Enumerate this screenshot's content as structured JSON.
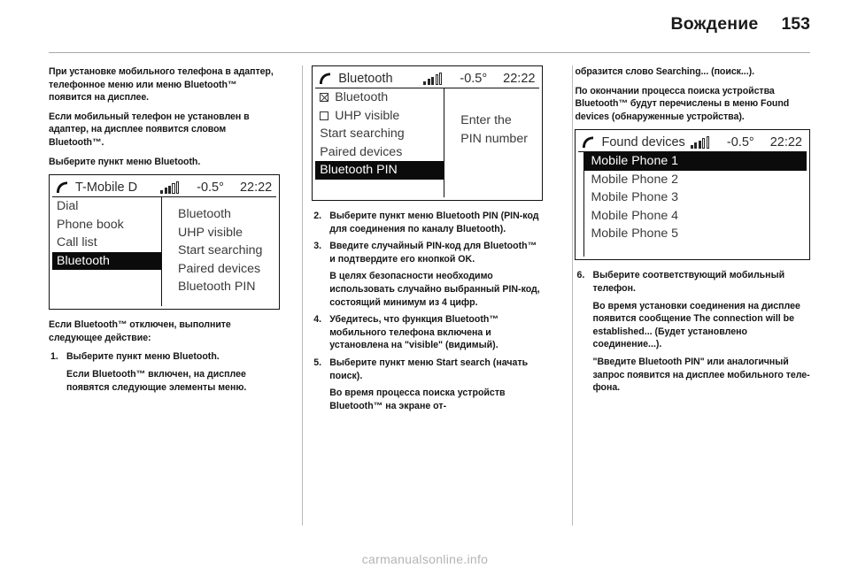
{
  "header": {
    "title": "Вождение",
    "page_number": "153"
  },
  "column1": {
    "paragraphs": [
      "При установке мобильного телефона в адаптер, телефонное меню или меню Bluetooth™ появится на дисплее.",
      "Если мобильный телефон не установлен в адаптер, на дисплее появится словом Bluetooth™.",
      "Выберите пункт меню Bluetooth."
    ],
    "display": {
      "title": "T-Mobile D",
      "temperature": "-0.5°",
      "clock": "22:22",
      "menu_items": [
        {
          "label": "Dial",
          "selected": false,
          "checkbox": null
        },
        {
          "label": "Phone book",
          "selected": false,
          "checkbox": null
        },
        {
          "label": "Call list",
          "selected": false,
          "checkbox": null
        },
        {
          "label": "Bluetooth",
          "selected": true,
          "checkbox": null
        }
      ],
      "right_items": [
        "Bluetooth",
        "UHP visible",
        "Start searching",
        "Paired devices",
        "Bluetooth PIN"
      ]
    },
    "after_intro": "Если Bluetooth™ отключен, выполните следующее действие:",
    "steps": [
      {
        "num": "1.",
        "text": "Выберите пункт меню Bluetooth.",
        "note": "Если Bluetooth™ включен, на дисплее появятся следующие элементы меню."
      }
    ]
  },
  "column2": {
    "display": {
      "title": "Bluetooth",
      "temperature": "-0.5°",
      "clock": "22:22",
      "menu_items": [
        {
          "label": "Bluetooth",
          "selected": false,
          "checkbox": "checked"
        },
        {
          "label": "UHP visible",
          "selected": false,
          "checkbox": "unchecked"
        },
        {
          "label": "Start searching",
          "selected": false,
          "checkbox": null
        },
        {
          "label": "Paired devices",
          "selected": false,
          "checkbox": null
        },
        {
          "label": "Bluetooth PIN",
          "selected": true,
          "checkbox": null
        }
      ],
      "right_lines": [
        "Enter the",
        "PIN number"
      ]
    },
    "steps": [
      {
        "num": "2.",
        "text": "Выберите пункт меню Bluetooth PIN (PIN-код для соединения по каналу Bluetooth).",
        "note": ""
      },
      {
        "num": "3.",
        "text": "Введите случайный PIN-код для Bluetooth™ и подтвердите его кнопкой OK.",
        "note": "В целях безопасности необходимо использовать случайно выбранный PIN-код, состоящий минимум из 4 цифр."
      },
      {
        "num": "4.",
        "text": "Убедитесь, что функция Bluetooth™ мобильного телефона включена и установлена на \"visible\" (видимый).",
        "note": ""
      },
      {
        "num": "5.",
        "text": "Выберите пункт меню Start search (начать поиск).",
        "note": "Во время процесса поиска устройств Bluetooth™ на экране от-"
      }
    ]
  },
  "column3": {
    "paragraphs": [
      "образится слово Searching... (поиск...).",
      "По окончании процесса поиска устройства Bluetooth™ будут перечислены в меню Found devices (обнаруженные устройства)."
    ],
    "display": {
      "title": "Found devices",
      "temperature": "-0.5°",
      "clock": "22:22",
      "list_items": [
        {
          "label": "Mobile Phone 1",
          "selected": true
        },
        {
          "label": "Mobile Phone 2",
          "selected": false
        },
        {
          "label": "Mobile Phone 3",
          "selected": false
        },
        {
          "label": "Mobile Phone 4",
          "selected": false
        },
        {
          "label": "Mobile Phone 5",
          "selected": false
        }
      ]
    },
    "steps": [
      {
        "num": "6.",
        "text": "Выберите соответствующий мобильный телефон.",
        "note": "Во время установки соединения на дисплее появится сообщение The connection will be established... (Будет установлено соединение...)."
      }
    ],
    "closing": "\"Введите Bluetooth PIN\" или аналогичный запрос появится на дисплее мобильного теле­фона."
  },
  "watermark": "carmanualsonline.info"
}
